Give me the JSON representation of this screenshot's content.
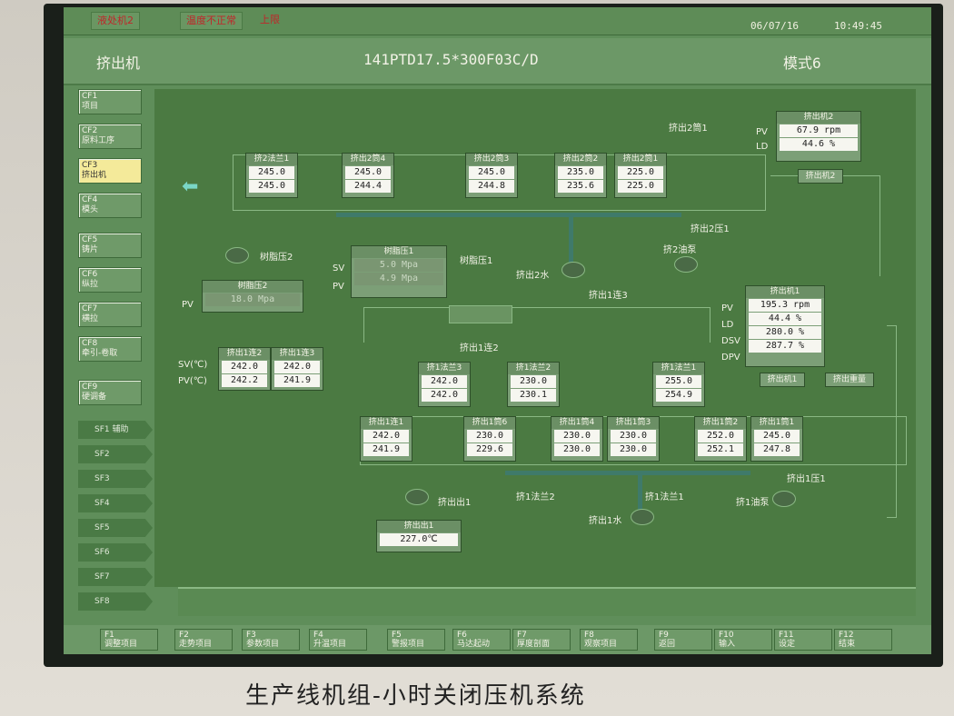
{
  "alarm": {
    "item1": "液处机2",
    "item2": "温度不正常",
    "item3": "上限"
  },
  "datetime": {
    "date": "06/07/16",
    "time": "10:49:45"
  },
  "header": {
    "left": "挤出机",
    "center": "141PTD17.5*300F03C/D",
    "right": "模式6"
  },
  "nav": [
    {
      "code": "CF1",
      "label": "项目"
    },
    {
      "code": "CF2",
      "label": "原料工序"
    },
    {
      "code": "CF3",
      "label": "挤出机"
    },
    {
      "code": "CF4",
      "label": "模头"
    },
    {
      "code": "CF5",
      "label": "铸片"
    },
    {
      "code": "CF6",
      "label": "纵拉"
    },
    {
      "code": "CF7",
      "label": "横拉"
    },
    {
      "code": "CF8",
      "label": "牵引-卷取"
    },
    {
      "code": "CF9",
      "label": "硬调备"
    }
  ],
  "sf": [
    "SF1 辅助",
    "SF2",
    "SF3",
    "SF4",
    "SF5",
    "SF6",
    "SF7",
    "SF8"
  ],
  "fkeys": [
    {
      "k": "F1",
      "l": "调整项目"
    },
    {
      "k": "F2",
      "l": "走势项目"
    },
    {
      "k": "F3",
      "l": "参数项目"
    },
    {
      "k": "F4",
      "l": "升温项目"
    },
    {
      "k": "F5",
      "l": "警报项目"
    },
    {
      "k": "F6",
      "l": "马达起动"
    },
    {
      "k": "F7",
      "l": "厚度剖面"
    },
    {
      "k": "F8",
      "l": "观察项目"
    },
    {
      "k": "F9",
      "l": "返回"
    },
    {
      "k": "F10",
      "l": "输入"
    },
    {
      "k": "F11",
      "l": "设定"
    },
    {
      "k": "F12",
      "l": "结束"
    }
  ],
  "top_row": [
    {
      "name": "挤2法兰1",
      "a": "245.0",
      "b": "245.0"
    },
    {
      "name": "挤出2筒4",
      "a": "245.0",
      "b": "244.4"
    },
    {
      "name": "挤出2筒3",
      "a": "245.0",
      "b": "244.8"
    },
    {
      "name": "挤出2筒2",
      "a": "235.0",
      "b": "235.6"
    },
    {
      "name": "挤出2筒1",
      "a": "225.0",
      "b": "225.0"
    }
  ],
  "resin2": {
    "title": "树脂压2",
    "value": "18.0",
    "unit": "Mpa",
    "label": "树脂压2",
    "pv": "PV"
  },
  "resin1": {
    "title": "树脂压1",
    "sv": "5.0",
    "pv": "4.9",
    "unit": "Mpa",
    "label": "树脂压1",
    "svl": "SV",
    "pvl": "PV"
  },
  "conn": {
    "title1": "挤出1连2",
    "title2": "挤出1连3",
    "sv1": "242.0",
    "pv1": "242.2",
    "sv2": "242.0",
    "pv2": "241.9",
    "svl": "SV(℃)",
    "pvl": "PV(℃)"
  },
  "ext2": {
    "title": "挤出机2",
    "pv": "67.9",
    "pvu": "rpm",
    "ld": "44.6",
    "ldu": "%",
    "pvl": "PV",
    "ldl": "LD",
    "btn": "挤出机2"
  },
  "ext1": {
    "title": "挤出机1",
    "pv": "195.3",
    "pvu": "rpm",
    "ld": "44.4",
    "ldu": "%",
    "dsv": "280.0",
    "dsvu": "%",
    "dpv": "287.7",
    "dpvu": "%",
    "pvl": "PV",
    "ldl": "LD",
    "dsvl": "DSV",
    "dpvl": "DPV",
    "btn": "挤出机1",
    "ctrl": "挤出重量"
  },
  "mid_row": [
    {
      "name": "挤1法兰3",
      "a": "242.0",
      "b": "242.0"
    },
    {
      "name": "挤1法兰2",
      "a": "230.0",
      "b": "230.1"
    },
    {
      "name": "挤1法兰1",
      "a": "255.0",
      "b": "254.9"
    }
  ],
  "bot_row": [
    {
      "name": "挤出1连1",
      "a": "242.0",
      "b": "241.9"
    },
    {
      "name": "挤出1筒6",
      "a": "230.0",
      "b": "229.6"
    },
    {
      "name": "挤出1筒4",
      "a": "230.0",
      "b": "230.0"
    },
    {
      "name": "挤出1筒3",
      "a": "230.0",
      "b": "230.0"
    },
    {
      "name": "挤出1筒2",
      "a": "252.0",
      "b": "252.1"
    },
    {
      "name": "挤出1筒1",
      "a": "245.0",
      "b": "247.8"
    }
  ],
  "ext_temp": {
    "title": "挤出出1",
    "value": "227.0℃"
  },
  "labels": {
    "e2c1": "挤出2筒1",
    "e2p": "挤出2压1",
    "e2pump": "挤2油泵",
    "e2w": "挤出2水",
    "e1c3": "挤出1连3",
    "e1c2": "挤出1连2",
    "e1out": "挤出出1",
    "f2": "挤1法兰2",
    "f1": "挤1法兰1",
    "w1": "挤出1水",
    "p1": "挤出1压1",
    "pump1": "挤1油泵"
  },
  "note": "生产线机组-小时关闭压机系统"
}
